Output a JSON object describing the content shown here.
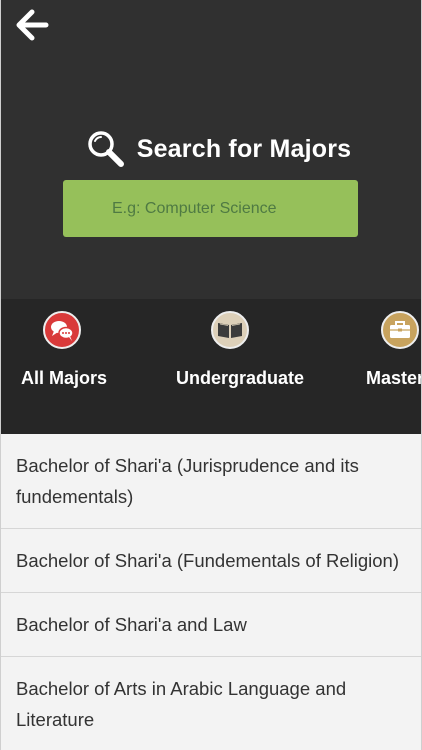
{
  "header": {
    "back_icon": "arrow-left-icon",
    "search_icon": "magnifier-icon",
    "search_title": "Search for Majors"
  },
  "search": {
    "placeholder": "E.g: Computer Science",
    "value": ""
  },
  "categories": [
    {
      "label": "All Majors",
      "icon": "chat-bubbles-icon",
      "color": "#d93a3a"
    },
    {
      "label": "Undergraduate",
      "icon": "book-icon",
      "color": "#ddd0b9"
    },
    {
      "label": "Masters",
      "icon": "briefcase-icon",
      "color": "#c8a35e"
    }
  ],
  "majors": [
    "Bachelor of Shari'a (Jurisprudence and its fundementals)",
    "Bachelor of Shari'a (Fundementals of Religion)",
    "Bachelor of Shari'a and Law",
    "Bachelor of Arts in Arabic Language and Literature"
  ],
  "colors": {
    "header_bg": "#303030",
    "categories_bg": "#262626",
    "search_box_bg": "#96c05a",
    "list_bg": "#f3f3f3"
  }
}
